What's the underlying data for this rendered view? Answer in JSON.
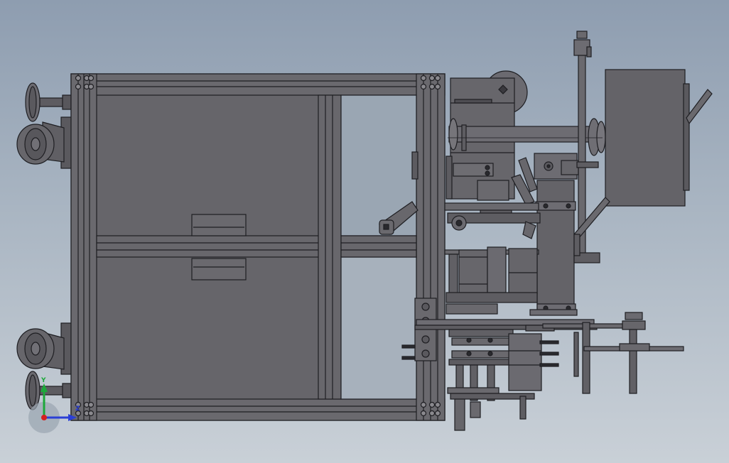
{
  "viewport": {
    "background_top": "#8e9db0",
    "background_bottom": "#c9d0d7",
    "body_fill": "#646368",
    "edge_color": "#1e1e22"
  },
  "triad": {
    "x_label": "X",
    "y_label": "Y",
    "z_label": "Z",
    "x_color": "#2b3fd6",
    "y_color": "#1ca83a",
    "z_color": "#d42020"
  }
}
